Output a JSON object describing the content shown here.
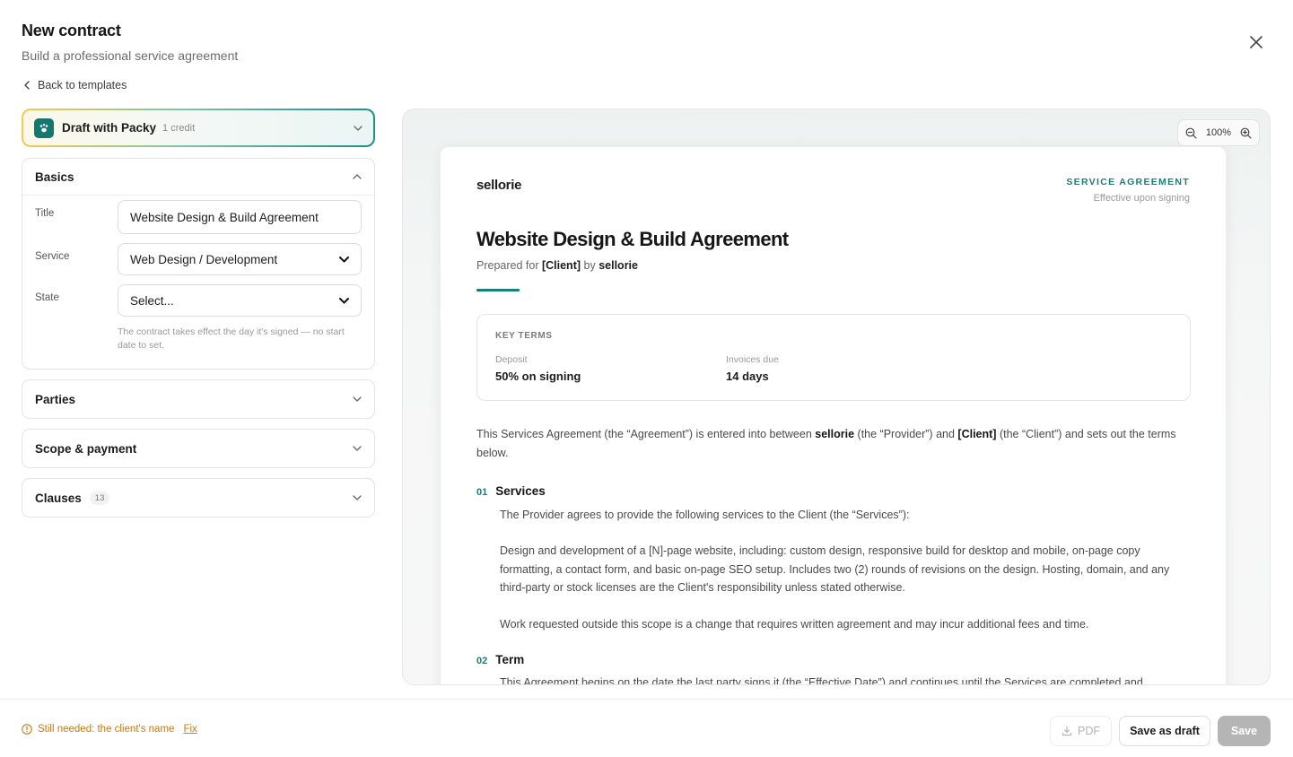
{
  "header": {
    "title": "New contract",
    "subtitle": "Build a professional service agreement"
  },
  "nav": {
    "back_label": "Back to templates"
  },
  "packy": {
    "label": "Draft with Packy",
    "credit": "1 credit"
  },
  "basics": {
    "heading": "Basics",
    "title_label": "Title",
    "title_value": "Website Design & Build Agreement",
    "service_label": "Service",
    "service_value": "Web Design / Development",
    "state_label": "State",
    "state_value": "Select...",
    "hint": "The contract takes effect the day it's signed — no start date to set."
  },
  "sections": {
    "parties": "Parties",
    "scope": "Scope & payment",
    "clauses": "Clauses",
    "clauses_count": "13"
  },
  "preview": {
    "zoom": "100%",
    "brand": "sellorie",
    "doc_type": "SERVICE AGREEMENT",
    "effective": "Effective upon signing",
    "title": "Website Design & Build Agreement",
    "prepared_prefix": "Prepared for",
    "prepared_client": "[Client]",
    "prepared_by": "by",
    "prepared_brand": "sellorie",
    "key_terms": {
      "heading": "KEY TERMS",
      "deposit_label": "Deposit",
      "deposit_value": "50% on signing",
      "invoices_label": "Invoices due",
      "invoices_value": "14 days"
    },
    "intro_a": "This Services Agreement (the “Agreement”) is entered into between",
    "intro_provider": "sellorie",
    "intro_b": "(the “Provider”) and",
    "intro_client": "[Client]",
    "intro_c": "(the “Client”) and sets out the terms below.",
    "s1_num": "01",
    "s1_title": "Services",
    "s1_p1": "The Provider agrees to provide the following services to the Client (the “Services”):",
    "s1_p2": "Design and development of a [N]-page website, including: custom design, responsive build for desktop and mobile, on-page copy formatting, a contact form, and basic on-page SEO setup. Includes two (2) rounds of revisions on the design. Hosting, domain, and any third-party or stock licenses are the Client's responsibility unless stated otherwise.",
    "s1_p3": "Work requested outside this scope is a change that requires written agreement and may incur additional fees and time.",
    "s2_num": "02",
    "s2_title": "Term",
    "s2_p1": "This Agreement begins on the date the last party signs it (the “Effective Date”) and continues until the Services are completed and"
  },
  "footer": {
    "warning": "Still needed: the client's name",
    "fix": "Fix",
    "pdf": "PDF",
    "save_draft": "Save as draft",
    "save": "Save"
  },
  "colors": {
    "accent": "#1a7f78",
    "warning": "#c97a12",
    "packy_gold": "#f2cc52"
  }
}
